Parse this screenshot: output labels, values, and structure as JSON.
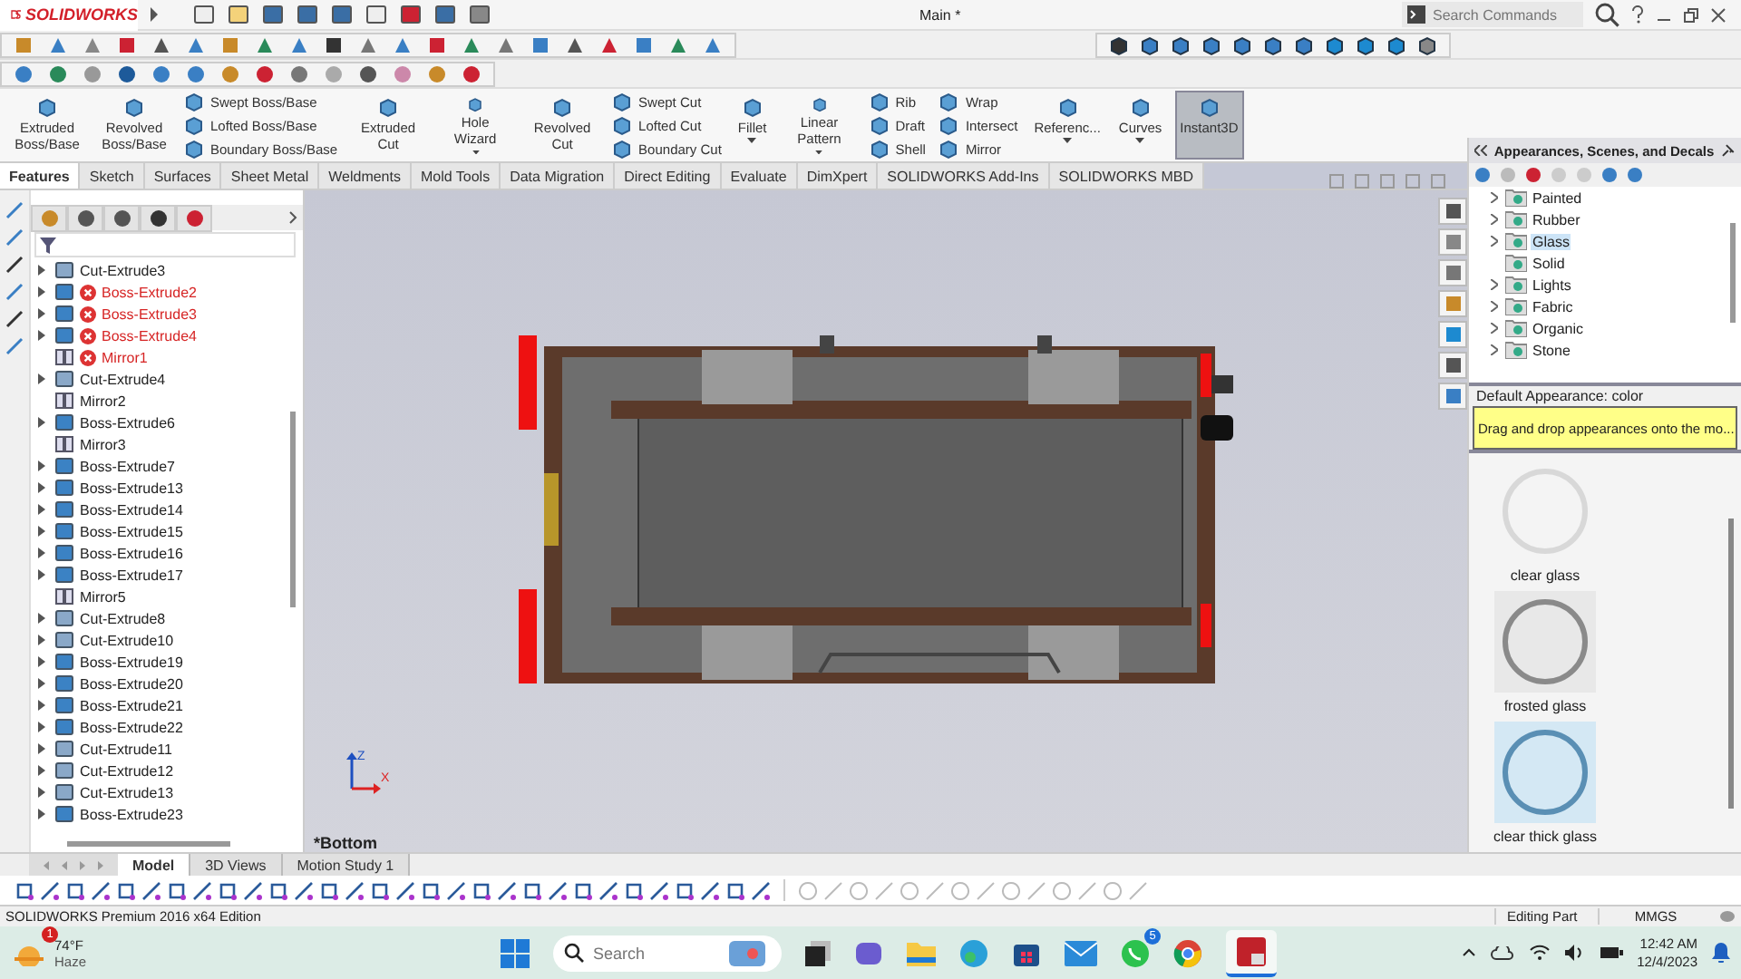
{
  "title_bar": {
    "logo": "SOLIDWORKS",
    "document_title": "Main *",
    "search": {
      "placeholder": "Search Commands"
    }
  },
  "command_manager": [
    {
      "kind": "large",
      "label": "Extruded Boss/Base",
      "dropdown": false,
      "on": false
    },
    {
      "kind": "large",
      "label": "Revolved Boss/Base",
      "dropdown": false,
      "on": false
    },
    {
      "kind": "stack",
      "items": [
        "Swept Boss/Base",
        "Lofted Boss/Base",
        "Boundary Boss/Base"
      ]
    },
    {
      "kind": "large",
      "label": "Extruded Cut",
      "dropdown": false,
      "on": false
    },
    {
      "kind": "large",
      "label": "Hole Wizard",
      "dropdown": true,
      "on": false
    },
    {
      "kind": "large",
      "label": "Revolved Cut",
      "dropdown": false,
      "on": false
    },
    {
      "kind": "stack",
      "items": [
        "Swept Cut",
        "Lofted Cut",
        "Boundary Cut"
      ]
    },
    {
      "kind": "large",
      "label": "Fillet",
      "dropdown": true,
      "on": false
    },
    {
      "kind": "large",
      "label": "Linear Pattern",
      "dropdown": true,
      "on": false
    },
    {
      "kind": "stack",
      "items": [
        "Rib",
        "Draft",
        "Shell"
      ]
    },
    {
      "kind": "stack",
      "items": [
        "Wrap",
        "Intersect",
        "Mirror"
      ]
    },
    {
      "kind": "large",
      "label": "Referenc...",
      "dropdown": true,
      "on": false
    },
    {
      "kind": "large",
      "label": "Curves",
      "dropdown": true,
      "on": false
    },
    {
      "kind": "large",
      "label": "Instant3D",
      "dropdown": false,
      "on": true
    }
  ],
  "tabs": [
    {
      "label": "Features",
      "selected": true
    },
    {
      "label": "Sketch",
      "selected": false
    },
    {
      "label": "Surfaces",
      "selected": false
    },
    {
      "label": "Sheet Metal",
      "selected": false
    },
    {
      "label": "Weldments",
      "selected": false
    },
    {
      "label": "Mold Tools",
      "selected": false
    },
    {
      "label": "Data Migration",
      "selected": false
    },
    {
      "label": "Direct Editing",
      "selected": false
    },
    {
      "label": "Evaluate",
      "selected": false
    },
    {
      "label": "DimXpert",
      "selected": false
    },
    {
      "label": "SOLIDWORKS Add-Ins",
      "selected": false
    },
    {
      "label": "SOLIDWORKS MBD",
      "selected": false
    }
  ],
  "feature_tree": [
    {
      "label": "Cut-Extrude3",
      "kind": "cut",
      "expandable": true,
      "error": false
    },
    {
      "label": "Boss-Extrude2",
      "kind": "boss",
      "expandable": true,
      "error": true
    },
    {
      "label": "Boss-Extrude3",
      "kind": "boss",
      "expandable": true,
      "error": true
    },
    {
      "label": "Boss-Extrude4",
      "kind": "boss",
      "expandable": true,
      "error": true
    },
    {
      "label": "Mirror1",
      "kind": "mirror",
      "expandable": false,
      "error": true
    },
    {
      "label": "Cut-Extrude4",
      "kind": "cut",
      "expandable": true,
      "error": false
    },
    {
      "label": "Mirror2",
      "kind": "mirror",
      "expandable": false,
      "error": false
    },
    {
      "label": "Boss-Extrude6",
      "kind": "boss",
      "expandable": true,
      "error": false
    },
    {
      "label": "Mirror3",
      "kind": "mirror",
      "expandable": false,
      "error": false
    },
    {
      "label": "Boss-Extrude7",
      "kind": "boss",
      "expandable": true,
      "error": false
    },
    {
      "label": "Boss-Extrude13",
      "kind": "boss",
      "expandable": true,
      "error": false
    },
    {
      "label": "Boss-Extrude14",
      "kind": "boss",
      "expandable": true,
      "error": false
    },
    {
      "label": "Boss-Extrude15",
      "kind": "boss",
      "expandable": true,
      "error": false
    },
    {
      "label": "Boss-Extrude16",
      "kind": "boss",
      "expandable": true,
      "error": false
    },
    {
      "label": "Boss-Extrude17",
      "kind": "boss",
      "expandable": true,
      "error": false
    },
    {
      "label": "Mirror5",
      "kind": "mirror",
      "expandable": false,
      "error": false
    },
    {
      "label": "Cut-Extrude8",
      "kind": "cut",
      "expandable": true,
      "error": false
    },
    {
      "label": "Cut-Extrude10",
      "kind": "cut",
      "expandable": true,
      "error": false
    },
    {
      "label": "Boss-Extrude19",
      "kind": "boss",
      "expandable": true,
      "error": false
    },
    {
      "label": "Boss-Extrude20",
      "kind": "boss",
      "expandable": true,
      "error": false
    },
    {
      "label": "Boss-Extrude21",
      "kind": "boss",
      "expandable": true,
      "error": false
    },
    {
      "label": "Boss-Extrude22",
      "kind": "boss",
      "expandable": true,
      "error": false
    },
    {
      "label": "Cut-Extrude11",
      "kind": "cut",
      "expandable": true,
      "error": false
    },
    {
      "label": "Cut-Extrude12",
      "kind": "cut",
      "expandable": true,
      "error": false
    },
    {
      "label": "Cut-Extrude13",
      "kind": "cut",
      "expandable": true,
      "error": false
    },
    {
      "label": "Boss-Extrude23",
      "kind": "boss",
      "expandable": true,
      "error": false
    }
  ],
  "viewport": {
    "view_name": "*Bottom",
    "axes": [
      "Z",
      "X"
    ]
  },
  "appearances_panel": {
    "title": "Appearances, Scenes, and Decals",
    "folders": [
      {
        "label": "Painted",
        "expandable": true,
        "selected": false
      },
      {
        "label": "Rubber",
        "expandable": true,
        "selected": false
      },
      {
        "label": "Glass",
        "expandable": true,
        "selected": true
      },
      {
        "label": "Solid",
        "expandable": false,
        "selected": false
      },
      {
        "label": "Lights",
        "expandable": true,
        "selected": false
      },
      {
        "label": "Fabric",
        "expandable": true,
        "selected": false
      },
      {
        "label": "Organic",
        "expandable": true,
        "selected": false
      },
      {
        "label": "Stone",
        "expandable": true,
        "selected": false
      }
    ],
    "default_appearance": "Default Appearance: color",
    "tooltip": "Drag and drop appearances onto the mo...",
    "swatches": [
      {
        "label": "clear glass",
        "kind": "clear"
      },
      {
        "label": "frosted glass",
        "kind": "frosted"
      },
      {
        "label": "clear thick glass",
        "kind": "thick"
      }
    ]
  },
  "bottom_tabs": [
    {
      "label": "Model",
      "selected": true
    },
    {
      "label": "3D Views",
      "selected": false
    },
    {
      "label": "Motion Study 1",
      "selected": false
    }
  ],
  "status_bar": {
    "edition": "SOLIDWORKS Premium 2016 x64 Edition",
    "mode": "Editing Part",
    "units": "MMGS"
  },
  "taskbar": {
    "weather": {
      "temperature": "74°F",
      "condition": "Haze",
      "badge": "1"
    },
    "search": {
      "placeholder": "Search"
    },
    "whatsapp_badge": "5",
    "time": "12:42 AM",
    "date": "12/4/2023"
  }
}
